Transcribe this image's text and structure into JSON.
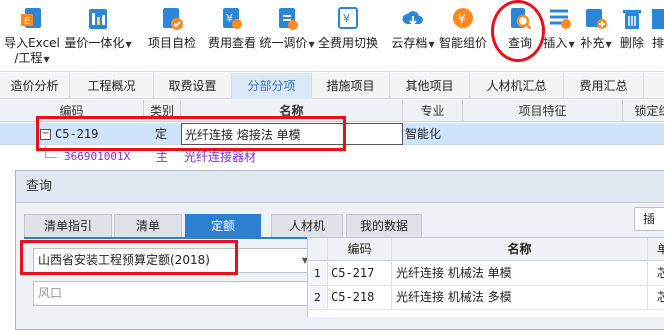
{
  "toolbar": {
    "buttons": [
      {
        "label": "导入Excel",
        "label2": "/工程",
        "icon": "import-excel-icon"
      },
      {
        "label": "量价一体化",
        "icon": "price-integration-icon"
      },
      {
        "label": "项目自检",
        "icon": "project-check-icon"
      },
      {
        "label": "费用查看",
        "icon": "fee-view-icon"
      },
      {
        "label": "统一调价",
        "icon": "adjust-price-icon"
      },
      {
        "label": "全费用切换",
        "icon": "full-cost-switch-icon"
      },
      {
        "label": "云存档",
        "icon": "cloud-archive-icon"
      },
      {
        "label": "智能组价",
        "icon": "smart-pricing-icon"
      },
      {
        "label": "查询",
        "icon": "query-icon"
      },
      {
        "label": "插入",
        "icon": "insert-icon"
      },
      {
        "label": "补充",
        "icon": "supplement-icon"
      },
      {
        "label": "删除",
        "icon": "delete-icon"
      },
      {
        "label": "排",
        "icon": "sort-icon"
      }
    ]
  },
  "tabs": [
    "造价分析",
    "工程概况",
    "取费设置",
    "分部分项",
    "措施项目",
    "其他项目",
    "人材机汇总",
    "费用汇总"
  ],
  "active_tab": "分部分项",
  "grid": {
    "headers": [
      "编码",
      "类别",
      "名称",
      "专业",
      "项目特征",
      "锁定综"
    ],
    "rows": [
      {
        "code": "C5-219",
        "type": "定",
        "name": "光纤连接 熔接法 单模",
        "major": "智能化"
      },
      {
        "code": "366901001X",
        "type": "主",
        "name": "光纤连接器材",
        "major": ""
      }
    ]
  },
  "dialog": {
    "title": "查询",
    "tabs": [
      "清单指引",
      "清单",
      "定额",
      "人材机",
      "我的数据"
    ],
    "active_tab": "定额",
    "quota_library": "山西省安装工程预算定额(2018)",
    "search_placeholder": "风口",
    "side_button": "插",
    "result_headers": [
      "编码",
      "名称",
      "单"
    ],
    "results": [
      {
        "index": "1",
        "code": "C5-217",
        "name": "光纤连接 机械法 单模",
        "unit": "芯"
      },
      {
        "index": "2",
        "code": "C5-218",
        "name": "光纤连接 机械法 多模",
        "unit": "芯"
      }
    ]
  },
  "colors": {
    "accent": "#2f7fd1",
    "highlight_red": "#e8111b",
    "selected_row": "#cfe3fb",
    "material_purple": "#8a2be2"
  }
}
